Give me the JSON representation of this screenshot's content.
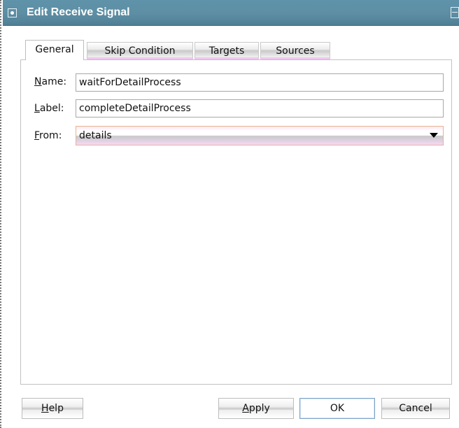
{
  "window": {
    "title": "Edit Receive Signal",
    "accent": "#5d8ea4"
  },
  "tabs": [
    {
      "label": "General",
      "active": true
    },
    {
      "label": "Skip Condition",
      "active": false
    },
    {
      "label": "Targets",
      "active": false
    },
    {
      "label": "Sources",
      "active": false
    }
  ],
  "form": {
    "name": {
      "label_mnemonic": "N",
      "label_rest": "ame:",
      "value": "waitForDetailProcess"
    },
    "label": {
      "label_mnemonic": "L",
      "label_rest": "abel:",
      "value": "completeDetailProcess"
    },
    "from": {
      "label_mnemonic": "F",
      "label_rest": "rom:",
      "value": "details"
    }
  },
  "buttons": {
    "help": {
      "mnemonic": "H",
      "rest": "elp"
    },
    "apply": {
      "mnemonic": "A",
      "rest": "pply"
    },
    "ok": {
      "label": "OK"
    },
    "cancel": {
      "label": "Cancel"
    }
  }
}
